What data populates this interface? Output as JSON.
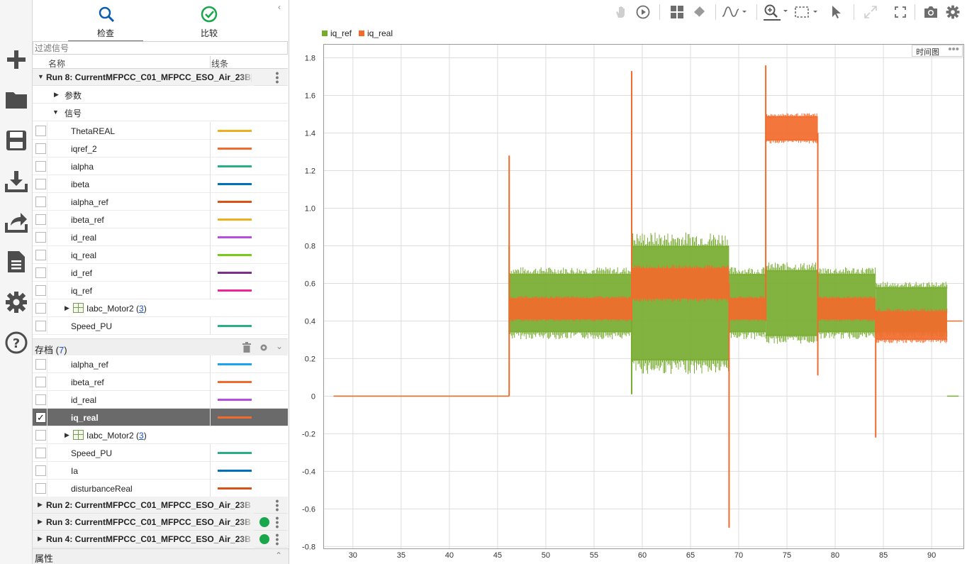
{
  "panel": {
    "tabs": [
      {
        "label": "检查",
        "icon": "search-icon"
      },
      {
        "label": "比较",
        "icon": "check-circle-icon"
      }
    ],
    "filter_placeholder": "过滤信号",
    "columns": {
      "name": "名称",
      "line": "线条"
    },
    "run8_label": "Run 8: CurrentMFPCC_C01_MFPCC_ESO_Air_23B[",
    "params_label": "参数",
    "signals_label": "信号",
    "signals": [
      {
        "name": "ThetaREAL",
        "color": "#EDB120"
      },
      {
        "name": "iqref_2",
        "color": "#F26B2D"
      },
      {
        "name": "ialpha",
        "color": "#2AAE86"
      },
      {
        "name": "ibeta",
        "color": "#0072BD"
      },
      {
        "name": "ialpha_ref",
        "color": "#D95319"
      },
      {
        "name": "ibeta_ref",
        "color": "#EDB120"
      },
      {
        "name": "id_real",
        "color": "#B54FE0"
      },
      {
        "name": "iq_real",
        "color": "#77CC1A"
      },
      {
        "name": "id_ref",
        "color": "#7E2F8E"
      },
      {
        "name": "iq_ref",
        "color": "#F0259A"
      }
    ],
    "iabc1": {
      "name": "Iabc_Motor2",
      "count": "3"
    },
    "speed1": {
      "name": "Speed_PU",
      "color": "#2AAE86"
    },
    "archive": {
      "label": "存档",
      "count": "7"
    },
    "archive_signals": [
      {
        "name": "ialpha_ref",
        "color": "#1AA3F0",
        "checked": false
      },
      {
        "name": "ibeta_ref",
        "color": "#F26B2D",
        "checked": false
      },
      {
        "name": "id_real",
        "color": "#B54FE0",
        "checked": false
      },
      {
        "name": "iq_real",
        "color": "#F26B2D",
        "checked": true
      }
    ],
    "iabc2": {
      "name": "Iabc_Motor2",
      "count": "3"
    },
    "archive_signals2": [
      {
        "name": "Speed_PU",
        "color": "#2AAE86"
      },
      {
        "name": "Ia",
        "color": "#0072BD"
      },
      {
        "name": "disturbanceReal",
        "color": "#D95319"
      }
    ],
    "runs": [
      {
        "label": "Run 2: CurrentMFPCC_C01_MFPCC_ESO_Air_23B",
        "dot": false
      },
      {
        "label": "Run 3: CurrentMFPCC_C01_MFPCC_ESO_Air_23B",
        "dot": true
      },
      {
        "label": "Run 4: CurrentMFPCC_C01_MFPCC_ESO_Air_23B",
        "dot": true
      }
    ],
    "properties_label": "属性"
  },
  "rail_icons": [
    "plus-icon",
    "folder-icon",
    "save-icon",
    "download-icon",
    "share-icon",
    "report-icon",
    "settings-icon",
    "help-icon"
  ],
  "toolbar_icons": [
    "pan-hand-icon",
    "play-icon",
    "layout-grid-icon",
    "eraser-icon",
    "signal-wave-icon",
    "zoom-icon",
    "zoom-box-icon",
    "cursor-icon",
    "expand-icon",
    "fullscreen-icon",
    "camera-icon",
    "gear-icon"
  ],
  "plot": {
    "badge_label": "时间图",
    "colors": {
      "iq_ref": "#77AC30",
      "iq_real": "#F26B2D"
    }
  },
  "chart_data": {
    "type": "line",
    "title": "",
    "xlabel": "",
    "ylabel": "",
    "xlim": [
      27,
      93.3
    ],
    "ylim": [
      -0.81,
      1.87
    ],
    "xticks": [
      30,
      35,
      40,
      45,
      50,
      55,
      60,
      65,
      70,
      75,
      80,
      85,
      90
    ],
    "yticks": [
      -0.8,
      -0.6,
      -0.4,
      -0.2,
      0,
      0.2,
      0.4,
      0.6,
      0.8,
      1.0,
      1.2,
      1.4,
      1.6,
      1.8
    ],
    "ytick_labels": [
      "-0.8",
      "-0.6",
      "-0.4",
      "-0.2",
      "0",
      "0.2",
      "0.4",
      "0.6",
      "0.8",
      "1.0",
      "1.2",
      "1.4",
      "1.6",
      "1.8"
    ],
    "grid": true,
    "legend": "top-left",
    "series": [
      {
        "name": "iq_ref",
        "color": "#77AC30",
        "kind": "band",
        "segments": [
          {
            "x": [
              28,
              46.2
            ],
            "low": 0,
            "high": 0
          },
          {
            "x": [
              46.2,
              58.9
            ],
            "low": 0.34,
            "high": 0.65
          },
          {
            "x": [
              58.9,
              69
            ],
            "low": 0.19,
            "high": 0.8
          },
          {
            "x": [
              69,
              72.8
            ],
            "low": 0.34,
            "high": 0.65
          },
          {
            "x": [
              72.8,
              78.2
            ],
            "low": 0.32,
            "high": 0.67
          },
          {
            "x": [
              78.2,
              84.2
            ],
            "low": 0.34,
            "high": 0.65
          },
          {
            "x": [
              84.2,
              91.6
            ],
            "low": 0.34,
            "high": 0.58
          },
          {
            "x": [
              91.6,
              92.8
            ],
            "low": 0,
            "high": 0
          }
        ],
        "spikes": [
          {
            "x": 46.2,
            "from": 0.8,
            "to": 0.33
          },
          {
            "x": 58.9,
            "from": 0.85,
            "to": 0.01
          }
        ]
      },
      {
        "name": "iq_real",
        "color": "#F26B2D",
        "kind": "band",
        "segments": [
          {
            "x": [
              28,
              46.2
            ],
            "low": 0,
            "high": 0
          },
          {
            "x": [
              46.2,
              58.9
            ],
            "low": 0.41,
            "high": 0.52
          },
          {
            "x": [
              58.9,
              69
            ],
            "low": 0.52,
            "high": 0.68
          },
          {
            "x": [
              69,
              72.8
            ],
            "low": 0.41,
            "high": 0.52
          },
          {
            "x": [
              72.8,
              78.2
            ],
            "low": 1.36,
            "high": 1.49
          },
          {
            "x": [
              78.2,
              84.2
            ],
            "low": 0.41,
            "high": 0.52
          },
          {
            "x": [
              84.2,
              91.6
            ],
            "low": 0.3,
            "high": 0.45
          },
          {
            "x": [
              91.6,
              93.2
            ],
            "low": 0.4,
            "high": 0.4
          }
        ],
        "spikes": [
          {
            "x": 46.2,
            "from": 0,
            "to": 1.28
          },
          {
            "x": 58.9,
            "from": 0.4,
            "to": 1.73
          },
          {
            "x": 69,
            "from": 0.6,
            "to": -0.7
          },
          {
            "x": 72.8,
            "from": 0.4,
            "to": 1.76
          },
          {
            "x": 78.2,
            "from": 1.4,
            "to": 0.11
          },
          {
            "x": 84.2,
            "from": 0.45,
            "to": -0.22
          }
        ]
      }
    ]
  }
}
